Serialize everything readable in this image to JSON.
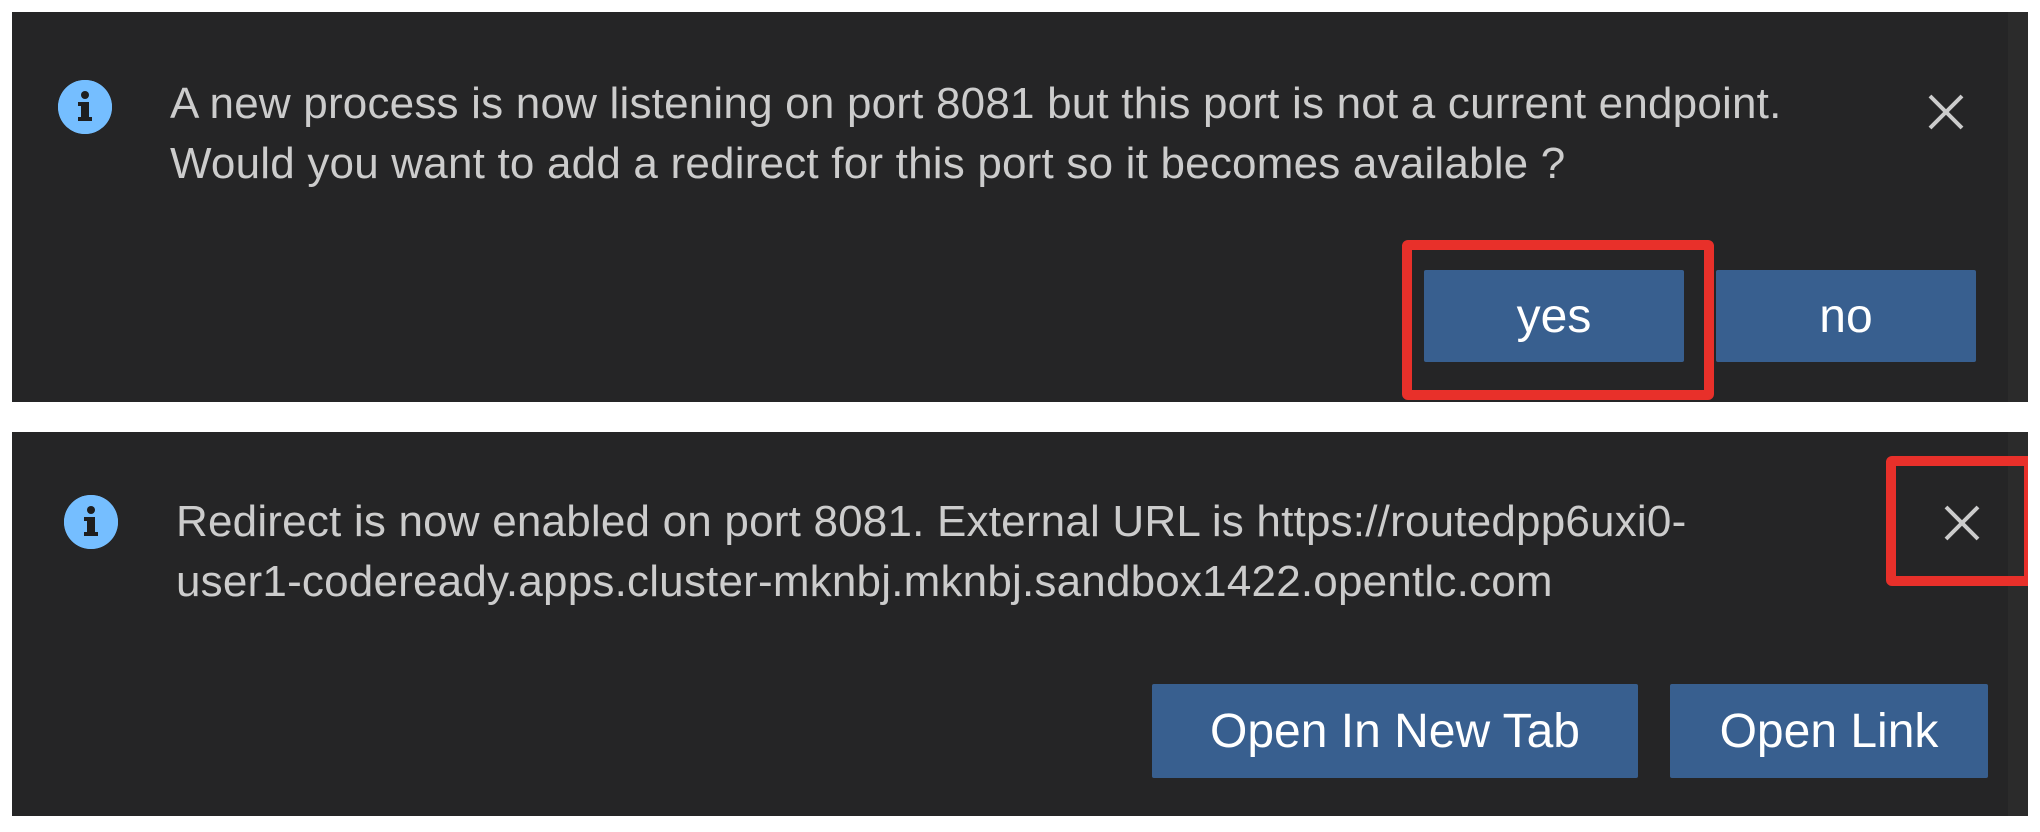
{
  "notifications": [
    {
      "message": "A new process is now listening on port 8081 but this port is not a current endpoint. Would you want to add a redirect for this port so it becomes available ?",
      "icon": "info-icon",
      "close_icon": "close-icon",
      "buttons": [
        {
          "label": "yes",
          "highlighted": true
        },
        {
          "label": "no",
          "highlighted": false
        }
      ],
      "close_highlighted": false
    },
    {
      "message": "Redirect is now enabled on port 8081. External URL is https://routedpp6uxi0-user1-codeready.apps.cluster-mknbj.mknbj.sandbox1422.opentlc.com",
      "icon": "info-icon",
      "close_icon": "close-icon",
      "buttons": [
        {
          "label": "Open In New Tab",
          "highlighted": false
        },
        {
          "label": "Open Link",
          "highlighted": false
        }
      ],
      "close_highlighted": true
    }
  ],
  "colors": {
    "toast_background": "#252526",
    "text": "#cccccc",
    "button": "#385f8f",
    "info": "#75beff",
    "highlight": "#e8302a"
  }
}
